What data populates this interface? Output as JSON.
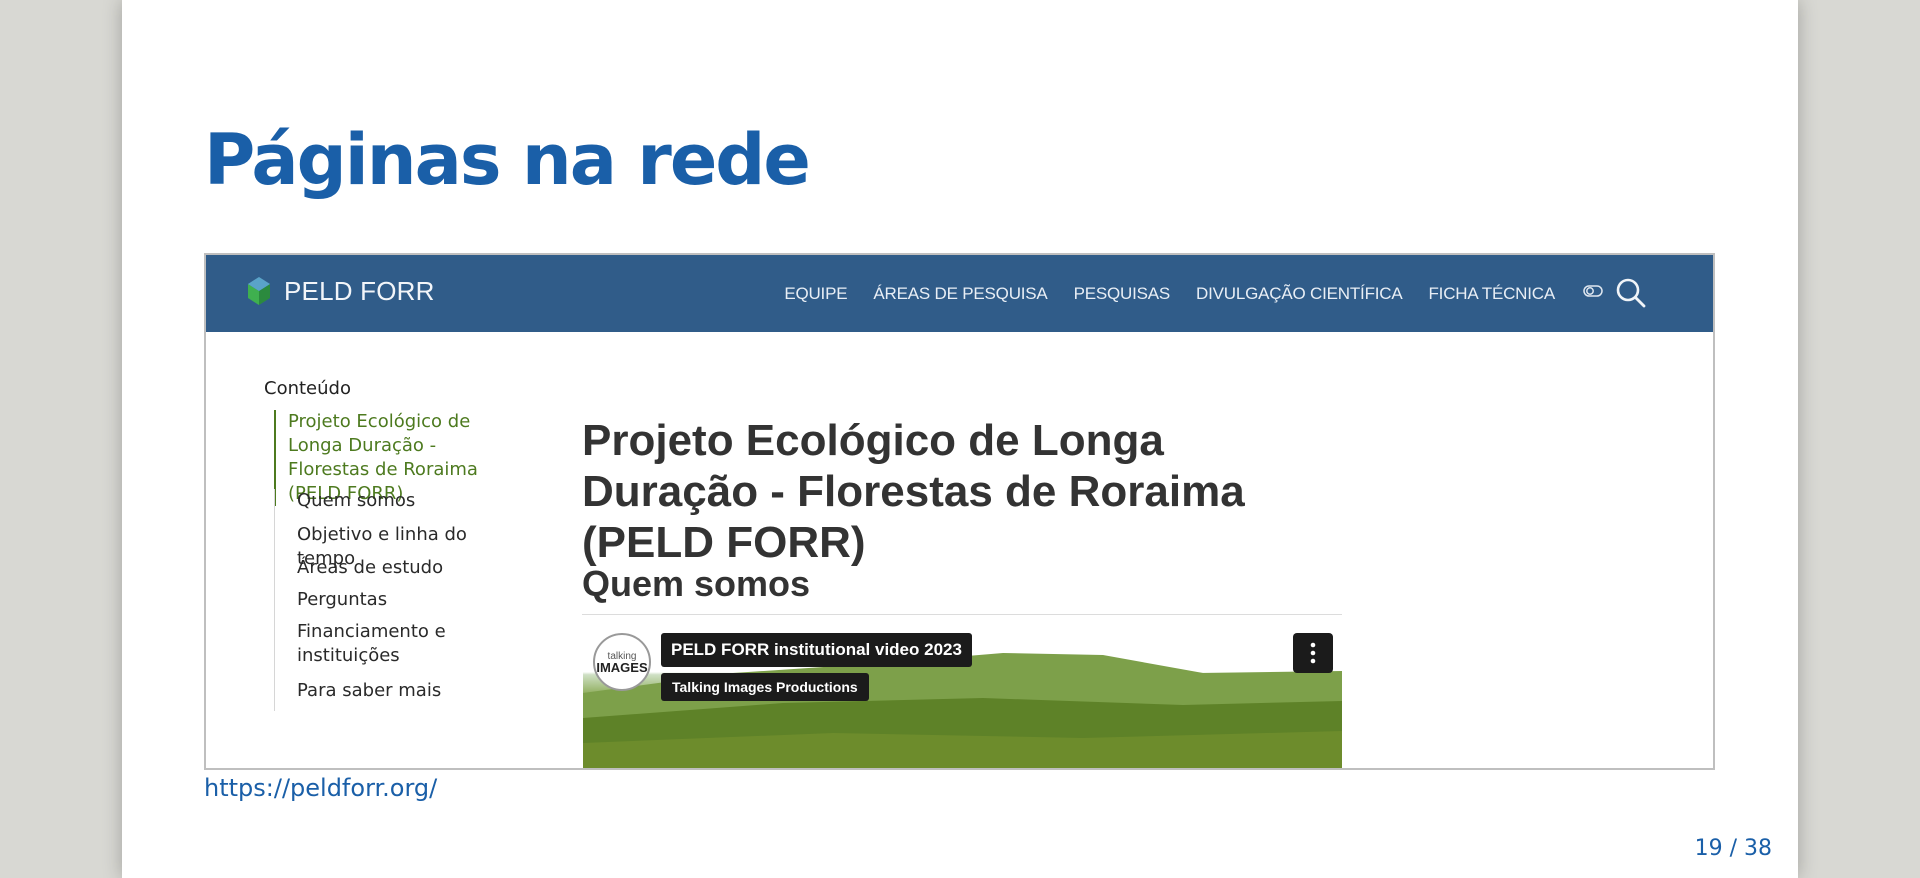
{
  "slide": {
    "title": "Páginas na rede",
    "link": "https://peldforr.org/",
    "page_number": "19 / 38"
  },
  "site": {
    "brand": "PELD FORR",
    "nav": [
      "EQUIPE",
      "ÁREAS DE PESQUISA",
      "PESQUISAS",
      "DIVULGAÇÃO CIENTÍFICA",
      "FICHA TÉCNICA"
    ],
    "icons": [
      "theme-toggle-icon",
      "search-icon"
    ],
    "toc": {
      "title": "Conteúdo",
      "active": "Projeto Ecológico de Longa Duração - Florestas de Roraima (PELD FORR)",
      "items": [
        "Quem somos",
        "Objetivo e linha do tempo",
        "Áreas de estudo",
        "Perguntas",
        "Financiamento e instituições",
        "Para saber mais"
      ]
    },
    "heading": "Projeto Ecológico de Longa Duração - Florestas de Roraima (PELD FORR)",
    "subheading": "Quem somos",
    "video": {
      "title": "PELD FORR institutional video 2023",
      "channel": "Talking Images Productions",
      "avatar_line1": "talking",
      "avatar_line2": "IMAGES"
    }
  }
}
